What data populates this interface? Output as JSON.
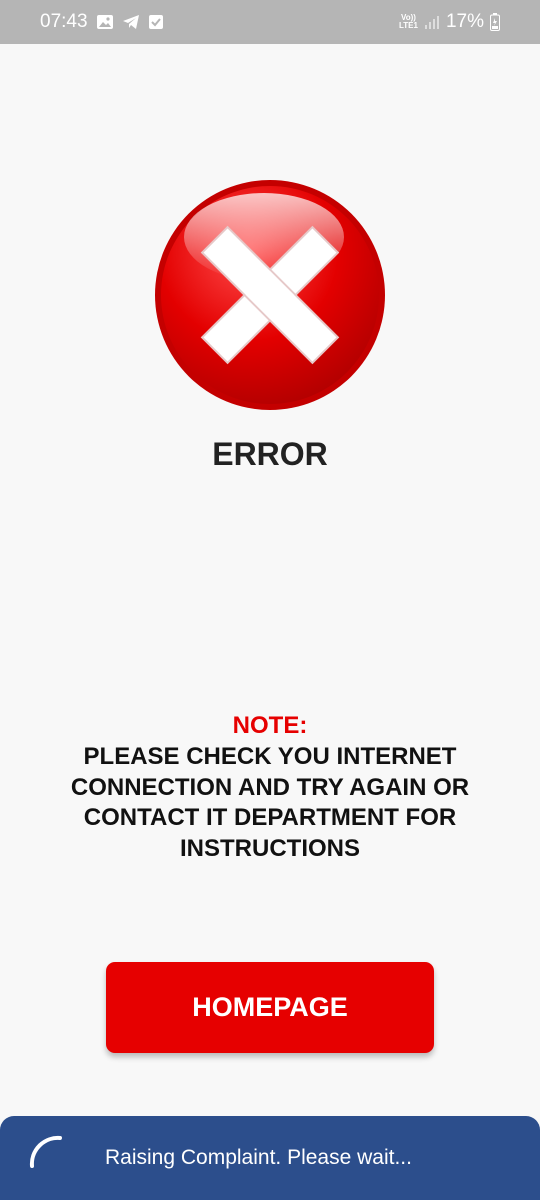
{
  "status_bar": {
    "time": "07:43",
    "icons_left": [
      "gallery-icon",
      "telegram-icon",
      "check-icon"
    ],
    "network_label_top": "Vo))",
    "network_label_bottom": "LTE1",
    "battery": "17%"
  },
  "error": {
    "title": "ERROR",
    "icon": "error-x-circle-icon",
    "color": "#e60000"
  },
  "note": {
    "label": "NOTE:",
    "lines": [
      "PLEASE CHECK YOU INTERNET",
      "CONNECTION AND TRY AGAIN OR",
      "CONTACT IT DEPARTMENT FOR",
      "INSTRUCTIONS"
    ]
  },
  "home_button": {
    "label": "HOMEPAGE",
    "color": "#e60000"
  },
  "progress": {
    "message": "Raising Complaint. Please wait...",
    "background": "#2c4e8c"
  }
}
